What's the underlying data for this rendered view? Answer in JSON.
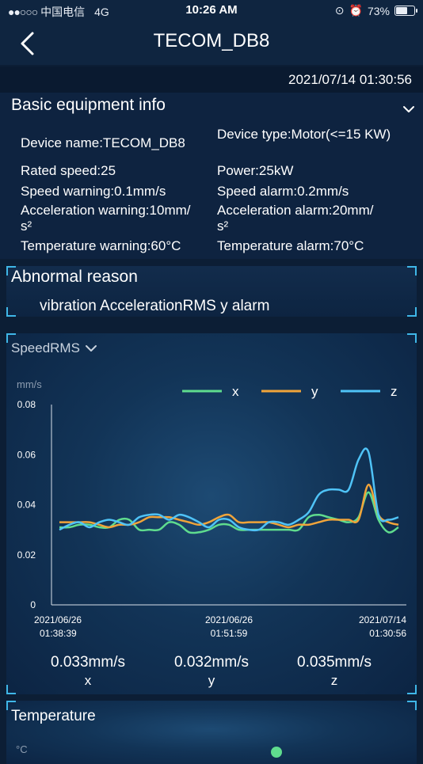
{
  "status_bar": {
    "carrier": "中国电信",
    "network": "4G",
    "time": "10:26 AM",
    "battery": "73%",
    "battery_level": 0.73
  },
  "header": {
    "title": "TECOM_DB8",
    "back_icon": "chevron-left-icon",
    "timestamp": "2021/07/14 01:30:56"
  },
  "basic_info": {
    "title": "Basic equipment info",
    "device_name": "Device name:TECOM_DB8",
    "device_type": "Device type:Motor(<=15 KW)",
    "rated_speed": "Rated speed:25",
    "power": "Power:25kW",
    "speed_warning": "Speed warning:0.1mm/s",
    "speed_alarm": "Speed alarm:0.2mm/s",
    "acc_warning_line1": "Acceleration warning:10mm/",
    "acc_warning_line2": "s²",
    "acc_alarm_line1": "Acceleration alarm:20mm/",
    "acc_alarm_line2": "s²",
    "temp_warning": "Temperature warning:60°C",
    "temp_alarm": "Temperature alarm:70°C"
  },
  "abnormal": {
    "title": "Abnormal reason",
    "reason": "vibration AccelerationRMS y alarm"
  },
  "speed_panel": {
    "selector": "SpeedRMS",
    "stats": [
      {
        "value": "0.033mm/s",
        "label": "x"
      },
      {
        "value": "0.032mm/s",
        "label": "y"
      },
      {
        "value": "0.035mm/s",
        "label": "z"
      }
    ]
  },
  "temperature_panel": {
    "title": "Temperature",
    "unit": "°C"
  },
  "colors": {
    "x": "#5fdc8e",
    "y": "#f0a43a",
    "z": "#4fc3f7",
    "accent": "#3fb7e8"
  },
  "chart_data": {
    "type": "line",
    "ylabel": "mm/s",
    "ylim": [
      0,
      0.08
    ],
    "yticks": [
      "0",
      "0.02",
      "0.04",
      "0.06",
      "0.08"
    ],
    "ytick_values": [
      0,
      0.02,
      0.04,
      0.06,
      0.08
    ],
    "xtick_labels": [
      [
        "2021/06/26",
        "01:38:39"
      ],
      [
        "2021/06/26",
        "01:51:59"
      ],
      [
        "2021/07/14",
        "01:30:56"
      ]
    ],
    "legend_position": "top-right",
    "series": [
      {
        "name": "x",
        "values": [
          0.031,
          0.031,
          0.032,
          0.032,
          0.031,
          0.031,
          0.034,
          0.034,
          0.03,
          0.03,
          0.03,
          0.033,
          0.032,
          0.029,
          0.029,
          0.03,
          0.032,
          0.032,
          0.03,
          0.03,
          0.03,
          0.03,
          0.03,
          0.03,
          0.03,
          0.035,
          0.036,
          0.035,
          0.034,
          0.033,
          0.035,
          0.045,
          0.034,
          0.029,
          0.031
        ]
      },
      {
        "name": "y",
        "values": [
          0.033,
          0.033,
          0.033,
          0.033,
          0.032,
          0.031,
          0.032,
          0.032,
          0.033,
          0.035,
          0.035,
          0.035,
          0.034,
          0.033,
          0.032,
          0.033,
          0.035,
          0.036,
          0.033,
          0.033,
          0.033,
          0.033,
          0.032,
          0.031,
          0.032,
          0.032,
          0.033,
          0.034,
          0.034,
          0.034,
          0.034,
          0.048,
          0.036,
          0.033,
          0.032
        ]
      },
      {
        "name": "z",
        "values": [
          0.03,
          0.032,
          0.033,
          0.031,
          0.033,
          0.034,
          0.033,
          0.032,
          0.035,
          0.036,
          0.036,
          0.034,
          0.036,
          0.035,
          0.033,
          0.031,
          0.034,
          0.034,
          0.031,
          0.03,
          0.03,
          0.033,
          0.033,
          0.032,
          0.034,
          0.037,
          0.044,
          0.046,
          0.046,
          0.046,
          0.058,
          0.061,
          0.036,
          0.034,
          0.035
        ]
      }
    ]
  }
}
